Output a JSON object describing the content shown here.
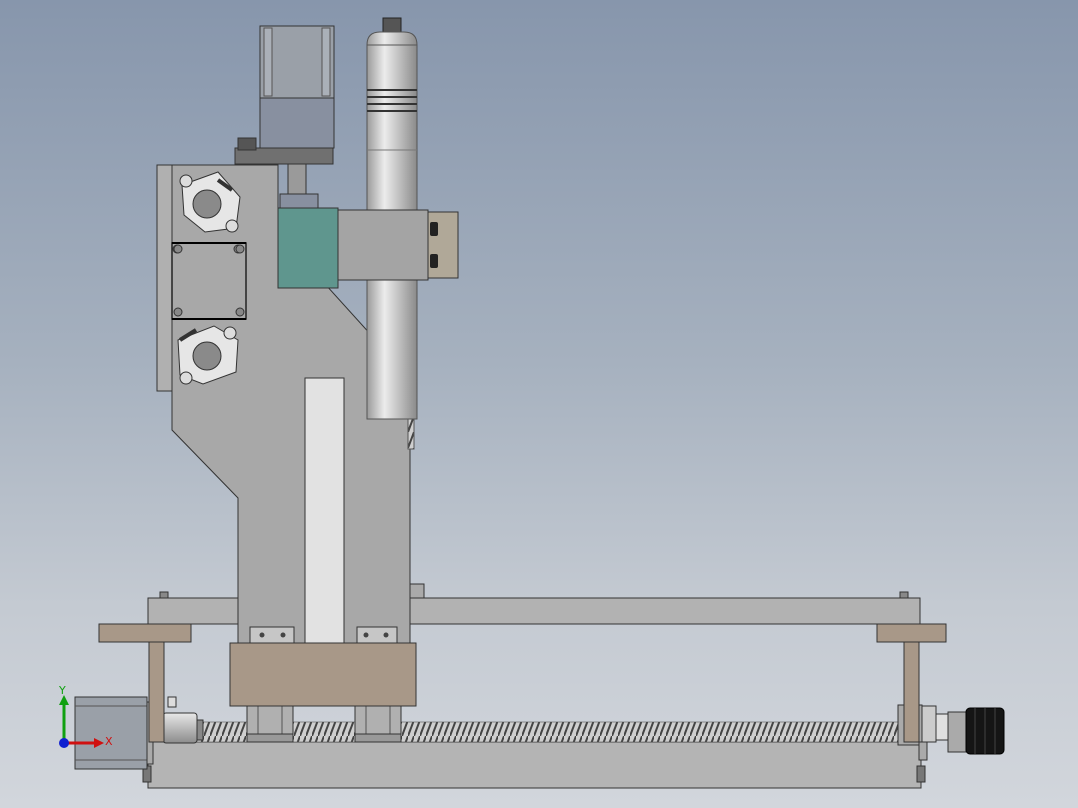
{
  "viewport": {
    "background_top": "#8796ac",
    "background_bottom": "#d2d6dc"
  },
  "triad": {
    "x_label": "X",
    "y_label": "Y",
    "x_color": "#d01010",
    "y_color": "#10a010",
    "z_color": "#1020d0"
  },
  "model": {
    "part_colors": {
      "frame": "#a8a8a8",
      "base_plate": "#b4b4b4",
      "bronze_block": "#a89888",
      "teal_block": "#5f968e",
      "motor": "#9098a4",
      "spindle": "#c8c8c8"
    }
  }
}
